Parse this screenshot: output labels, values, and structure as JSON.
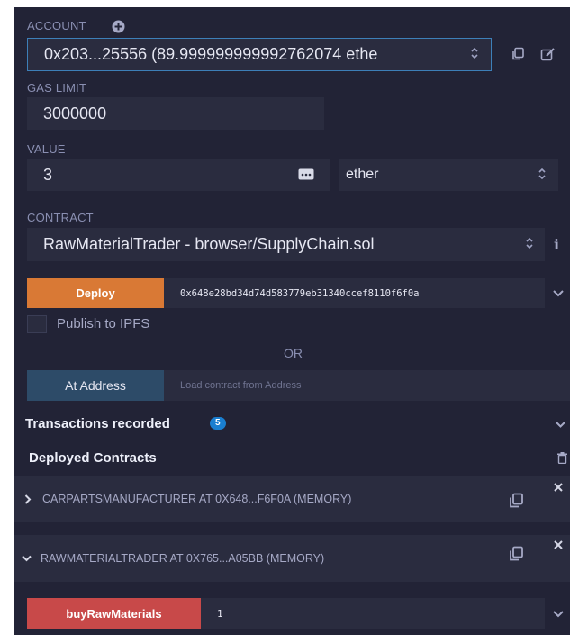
{
  "account": {
    "label": "ACCOUNT",
    "value": "0x203...25556 (89.999999999992762074 ethe"
  },
  "gas_limit": {
    "label": "GAS LIMIT",
    "value": "3000000"
  },
  "value": {
    "label": "VALUE",
    "amount": "3",
    "unit": "ether"
  },
  "contract": {
    "label": "CONTRACT",
    "selected": "RawMaterialTrader - browser/SupplyChain.sol"
  },
  "deploy": {
    "button_label": "Deploy",
    "constructor_arg": "0x648e28bd34d74d583779eb31340ccef8110f6f0a"
  },
  "publish": {
    "label": "Publish to IPFS",
    "checked": false
  },
  "or_text": "OR",
  "at_address": {
    "button_label": "At Address",
    "placeholder": "Load contract from Address"
  },
  "transactions": {
    "label": "Transactions recorded",
    "count": "5"
  },
  "deployed": {
    "heading": "Deployed Contracts",
    "instances": [
      {
        "name": "CARPARTSMANUFACTURER AT 0X648...F6F0A (MEMORY)",
        "expanded": false
      },
      {
        "name": "RAWMATERIALTRADER AT 0X765...A05BB (MEMORY)",
        "expanded": true
      }
    ]
  },
  "function_call": {
    "button_label": "buyRawMaterials",
    "arg_value": "1"
  },
  "colors": {
    "background": "#222336",
    "input": "#2a2c3f",
    "deploy_orange": "#d97935",
    "transact_red": "#c84949",
    "at_address_blue": "#2d4b68",
    "badge_blue": "#1a7fd1"
  },
  "icons": [
    "plus-circle-icon",
    "copy-icon",
    "edit-icon",
    "ellipsis-icon",
    "info-icon",
    "chevron-down-icon",
    "chevron-right-icon",
    "trash-icon",
    "close-icon",
    "select-arrows-icon"
  ]
}
